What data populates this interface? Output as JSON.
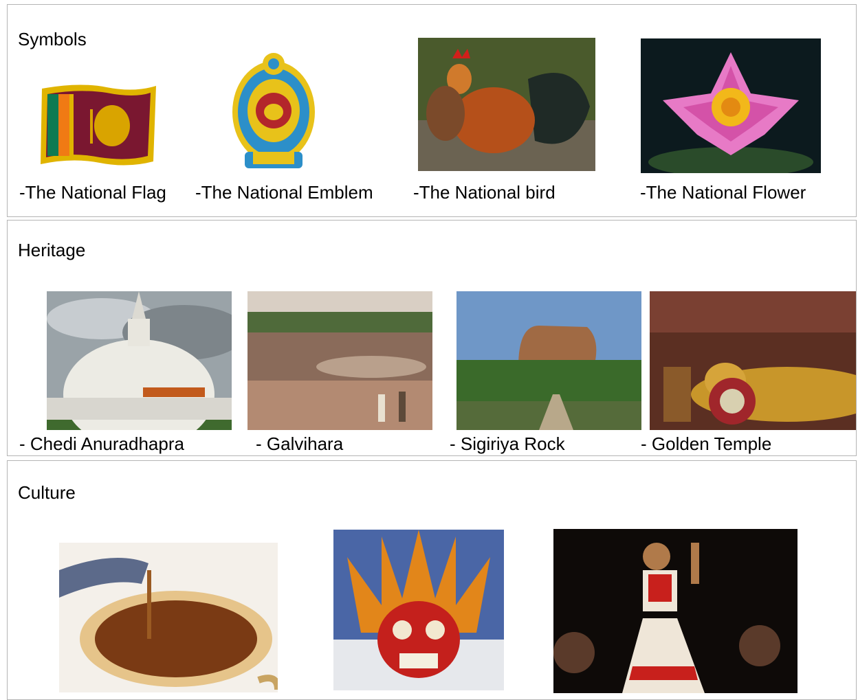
{
  "symbols": {
    "title": "Symbols",
    "items": [
      {
        "caption": "-The National Flag",
        "icon": "sri-lanka-flag-image"
      },
      {
        "caption": "-The National Emblem",
        "icon": "national-emblem-image"
      },
      {
        "caption": "-The National bird",
        "icon": "junglefowl-image"
      },
      {
        "caption": "-The National Flower",
        "icon": "water-lily-image"
      }
    ]
  },
  "heritage": {
    "title": "Heritage",
    "items": [
      {
        "caption": "- Chedi Anuradhapra",
        "icon": "stupa-image"
      },
      {
        "caption": "- Galvihara",
        "icon": "rock-buddha-image"
      },
      {
        "caption": "- Sigiriya Rock",
        "icon": "sigiriya-image"
      },
      {
        "caption": "- Golden Temple",
        "icon": "reclining-buddha-image"
      }
    ]
  },
  "culture": {
    "title": "Culture",
    "items": [
      {
        "icon": "tea-cup-image"
      },
      {
        "icon": "devil-mask-image"
      },
      {
        "icon": "kandyan-dancer-image"
      }
    ]
  }
}
